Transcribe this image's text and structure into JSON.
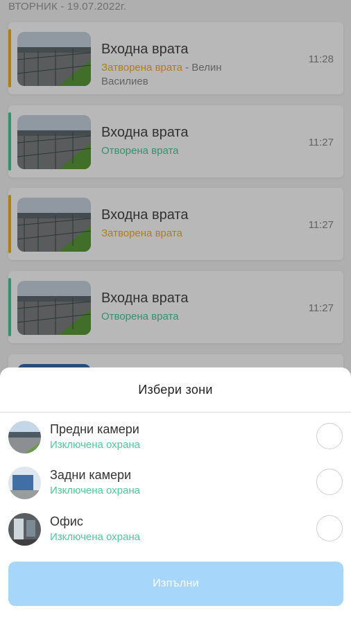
{
  "feed": {
    "date_label": "ВТОРНИК - 19.07.2022г.",
    "colors": {
      "closed": "#f2b01e",
      "open": "#4cc89a"
    },
    "events": [
      {
        "title": "Входна врата",
        "status": "Затворена врата",
        "status_kind": "closed",
        "actor": " - Велин Василиев",
        "time": "11:28"
      },
      {
        "title": "Входна врата",
        "status": "Отворена врата",
        "status_kind": "open",
        "actor": "",
        "time": "11:27"
      },
      {
        "title": "Входна врата",
        "status": "Затворена врата",
        "status_kind": "closed",
        "actor": "",
        "time": "11:27"
      },
      {
        "title": "Входна врата",
        "status": "Отворена врата",
        "status_kind": "open",
        "actor": "",
        "time": "11:27"
      }
    ]
  },
  "sheet": {
    "title": "Избери зони",
    "zones": [
      {
        "name": "Предни камери",
        "status": "Изключена охрана"
      },
      {
        "name": "Задни камери",
        "status": "Изключена охрана"
      },
      {
        "name": "Офис",
        "status": "Изключена охрана"
      }
    ],
    "submit_label": "Изпълни"
  }
}
